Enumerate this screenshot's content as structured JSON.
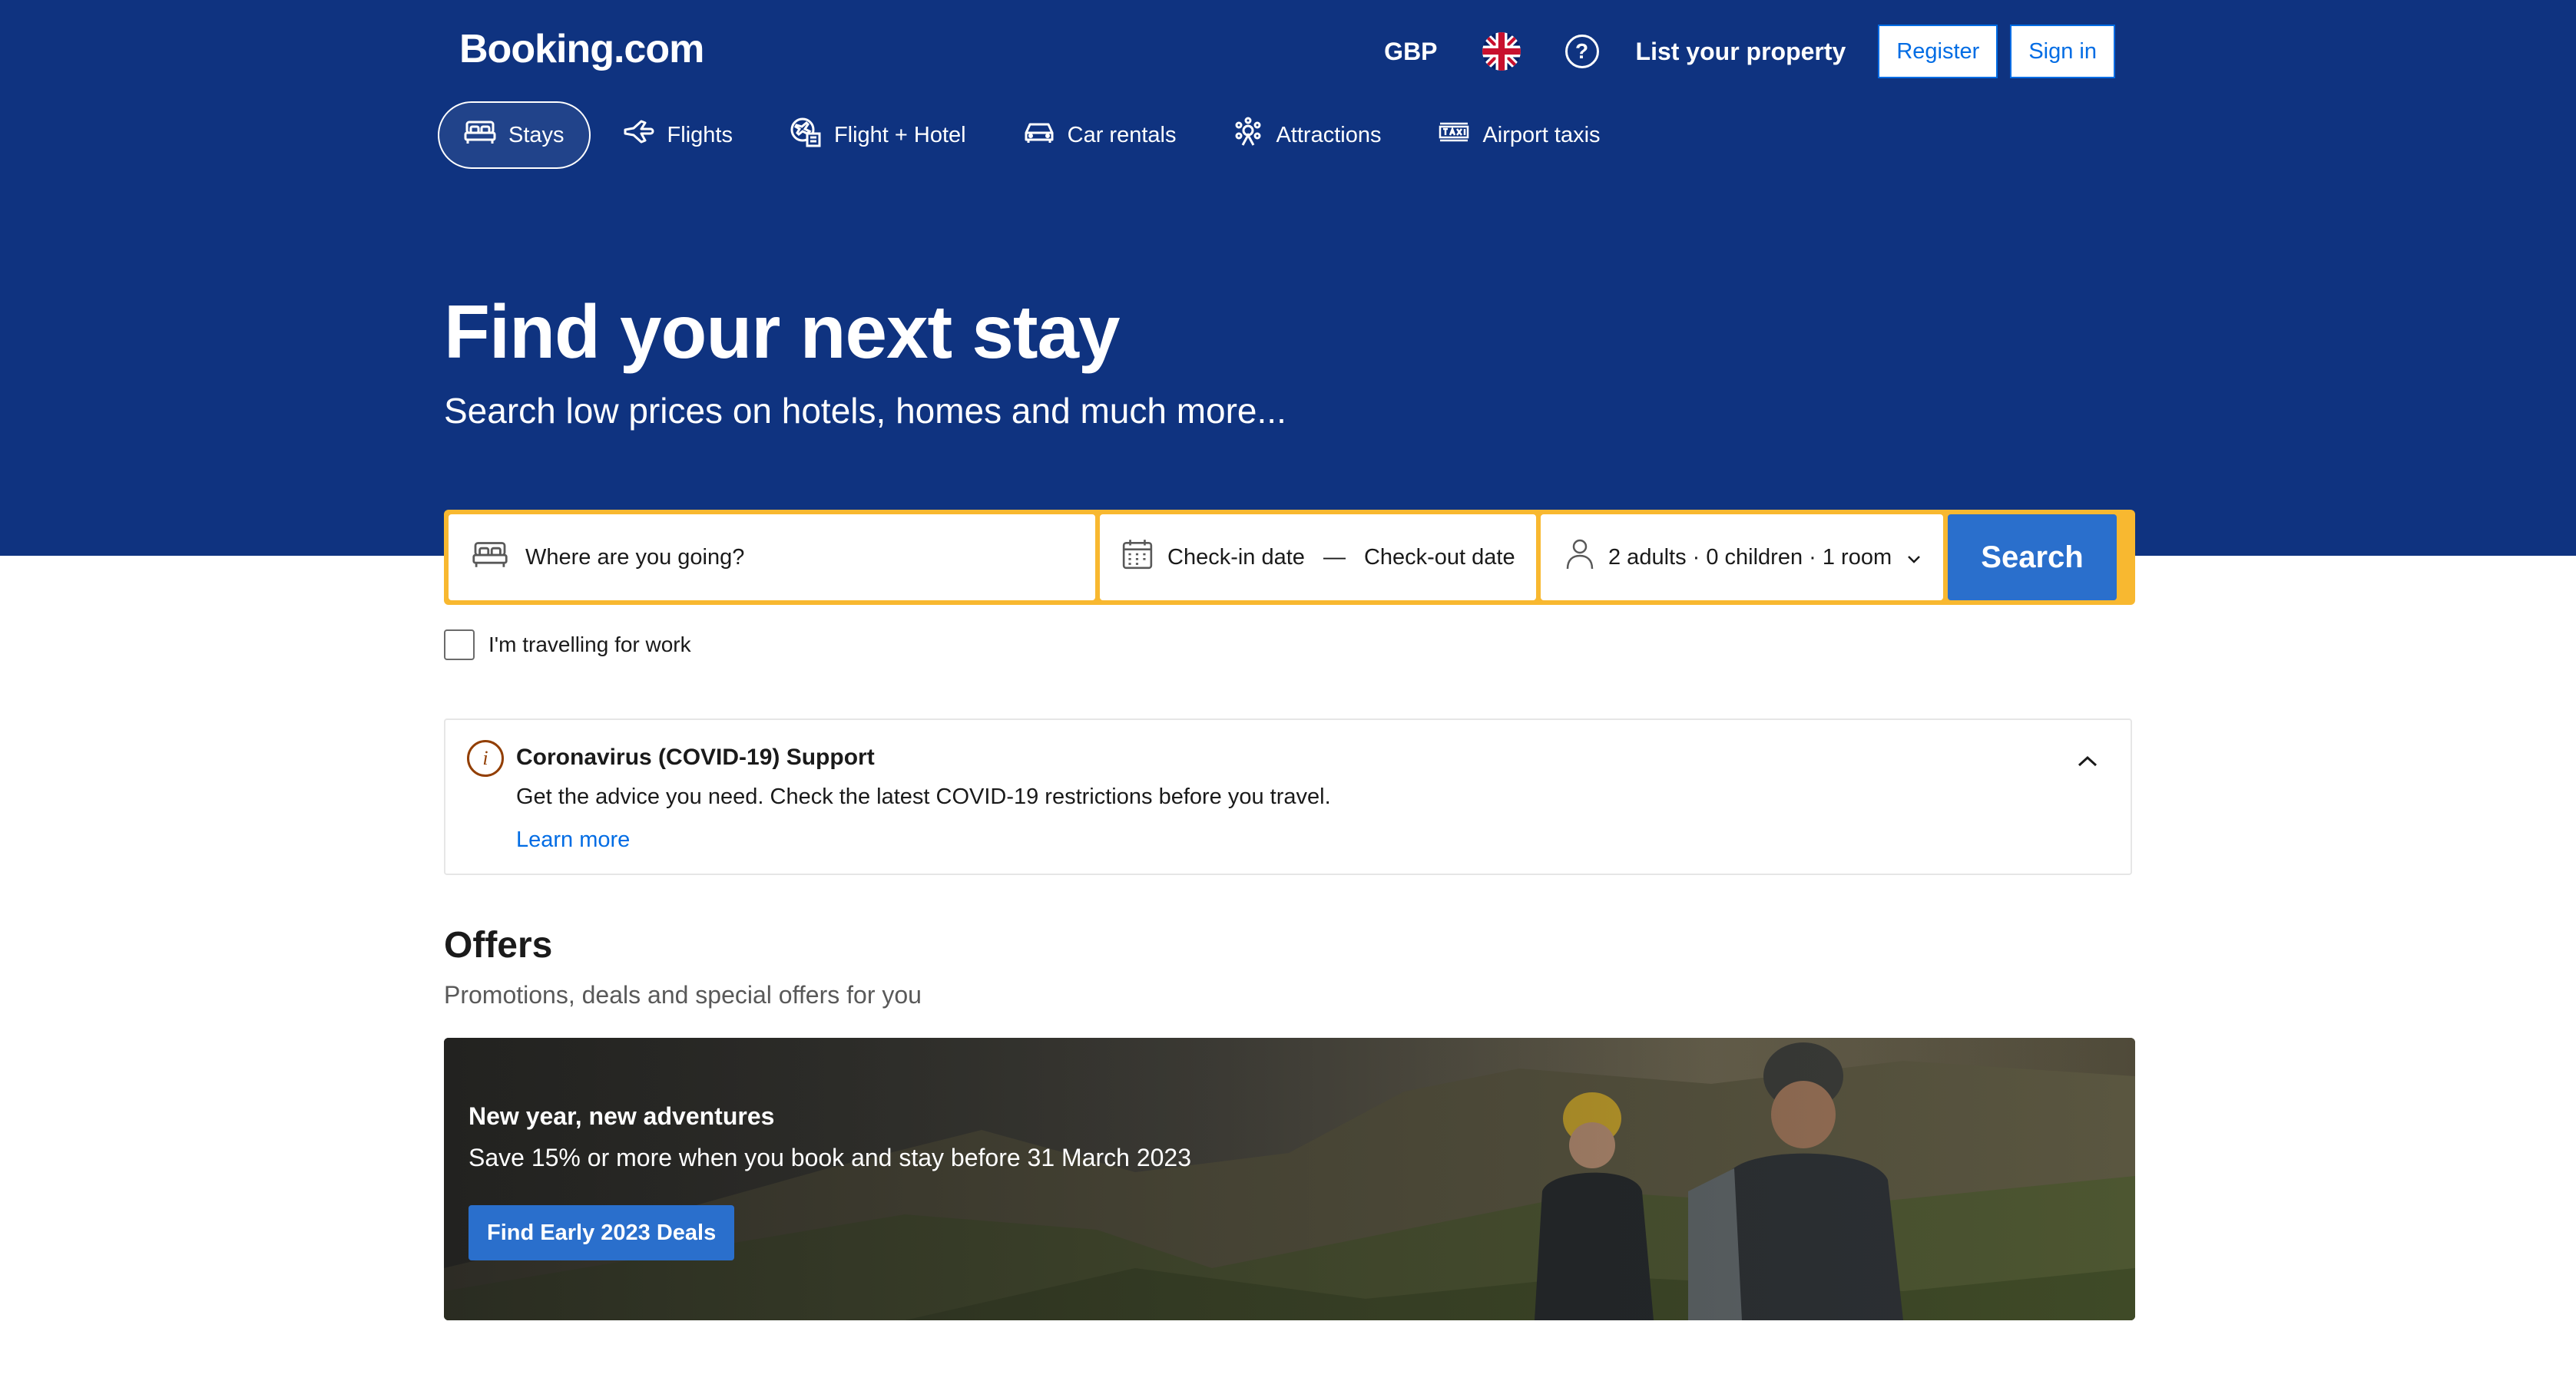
{
  "header": {
    "logo": "Booking.com",
    "currency": "GBP",
    "language_icon": "uk-flag-icon",
    "help_icon_label": "?",
    "list_property": "List your property",
    "register": "Register",
    "sign_in": "Sign in"
  },
  "nav": {
    "tabs": [
      {
        "label": "Stays",
        "icon": "bed-icon",
        "active": true
      },
      {
        "label": "Flights",
        "icon": "plane-icon",
        "active": false
      },
      {
        "label": "Flight + Hotel",
        "icon": "flight-hotel-icon",
        "active": false
      },
      {
        "label": "Car rentals",
        "icon": "car-icon",
        "active": false
      },
      {
        "label": "Attractions",
        "icon": "attractions-icon",
        "active": false
      },
      {
        "label": "Airport taxis",
        "icon": "taxi-icon",
        "active": false
      }
    ]
  },
  "hero": {
    "title": "Find your next stay",
    "subtitle": "Search low prices on hotels, homes and much more..."
  },
  "search": {
    "destination_placeholder": "Where are you going?",
    "checkin": "Check-in date",
    "separator": "—",
    "checkout": "Check-out date",
    "guests": "2 adults · 0 children · 1 room",
    "button": "Search"
  },
  "work_travel": {
    "label": "I'm travelling for work",
    "checked": false
  },
  "covid": {
    "icon_label": "i",
    "title": "Coronavirus (COVID-19) Support",
    "text": "Get the advice you need. Check the latest COVID-19 restrictions before you travel.",
    "link": "Learn more"
  },
  "offers": {
    "title": "Offers",
    "subtitle": "Promotions, deals and special offers for you",
    "card": {
      "title": "New year, new adventures",
      "text": "Save 15% or more when you book and stay before 31 March 2023",
      "button": "Find Early 2023 Deals"
    }
  },
  "colors": {
    "brand_blue": "#0f3380",
    "action_blue": "#2a6fcc",
    "search_border": "#f8b830",
    "link": "#006ce4",
    "covid_icon": "#923e01"
  }
}
